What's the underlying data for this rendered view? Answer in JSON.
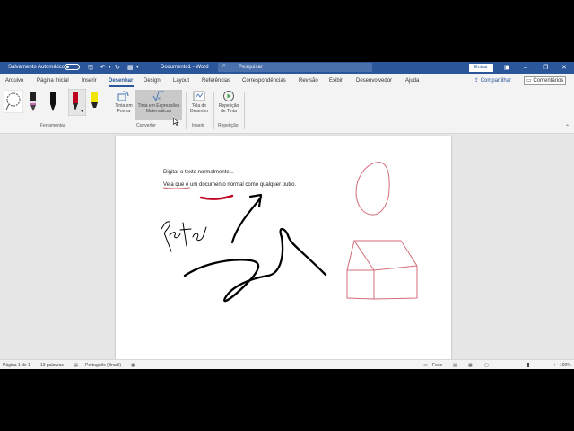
{
  "titlebar": {
    "autosave_label": "Salvamento Automático",
    "doc_title": "Documento1 - Word",
    "search_placeholder": "Pesquisar",
    "signin_label": "Entrar"
  },
  "tabs": [
    {
      "label": "Arquivo"
    },
    {
      "label": "Página Inicial"
    },
    {
      "label": "Inserir"
    },
    {
      "label": "Desenhar"
    },
    {
      "label": "Design"
    },
    {
      "label": "Layout"
    },
    {
      "label": "Referências"
    },
    {
      "label": "Correspondências"
    },
    {
      "label": "Revisão"
    },
    {
      "label": "Exibir"
    },
    {
      "label": "Desenvolvedor"
    },
    {
      "label": "Ajuda"
    }
  ],
  "active_tab": "Desenhar",
  "share_label": "Compartilhar",
  "comments_label": "Comentários",
  "ribbon": {
    "groups": {
      "ferramentas": "Ferramentas",
      "converter": "Converter",
      "inserir": "Inserir",
      "repeticao": "Repetição"
    },
    "buttons": {
      "ink_to_shape_1": "Tinta em",
      "ink_to_shape_2": "Forma",
      "ink_to_math_1": "Tinta em Expressões",
      "ink_to_math_2": "Matemáticas",
      "canvas_1": "Tela de",
      "canvas_2": "Desenho",
      "replay_1": "Repetição",
      "replay_2": "de Tinta"
    },
    "pen_colors": [
      "#222222",
      "#111111",
      "#c0001f",
      "#f2e600"
    ]
  },
  "document": {
    "line1": "Digitar o texto normalmente...",
    "line2": "Veja que é um documento normal como qualquer outro.",
    "handwriting": "Retea"
  },
  "statusbar": {
    "page": "Página 1 de 1",
    "words": "13 palavras",
    "language": "Português (Brasil)",
    "focus": "Foco",
    "zoom": "100%"
  },
  "colors": {
    "accent": "#2b579a",
    "ink_black": "#000000",
    "ink_red": "#c0001f",
    "ink_pink": "#d36a78"
  }
}
